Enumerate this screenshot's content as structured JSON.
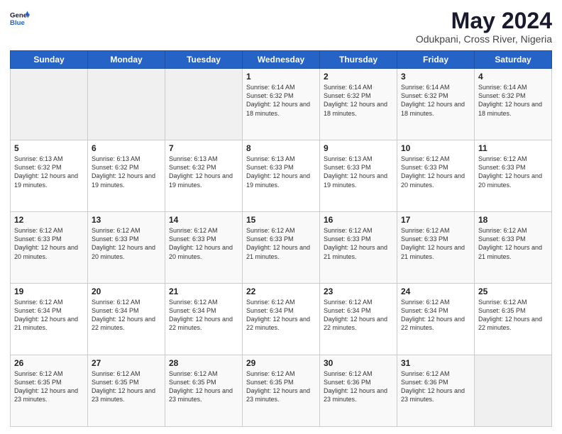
{
  "header": {
    "logo_general": "General",
    "logo_blue": "Blue",
    "month_title": "May 2024",
    "location": "Odukpani, Cross River, Nigeria"
  },
  "calendar": {
    "days_of_week": [
      "Sunday",
      "Monday",
      "Tuesday",
      "Wednesday",
      "Thursday",
      "Friday",
      "Saturday"
    ],
    "rows": [
      [
        {
          "day": "",
          "info": ""
        },
        {
          "day": "",
          "info": ""
        },
        {
          "day": "",
          "info": ""
        },
        {
          "day": "1",
          "info": "Sunrise: 6:14 AM\nSunset: 6:32 PM\nDaylight: 12 hours and 18 minutes."
        },
        {
          "day": "2",
          "info": "Sunrise: 6:14 AM\nSunset: 6:32 PM\nDaylight: 12 hours and 18 minutes."
        },
        {
          "day": "3",
          "info": "Sunrise: 6:14 AM\nSunset: 6:32 PM\nDaylight: 12 hours and 18 minutes."
        },
        {
          "day": "4",
          "info": "Sunrise: 6:14 AM\nSunset: 6:32 PM\nDaylight: 12 hours and 18 minutes."
        }
      ],
      [
        {
          "day": "5",
          "info": "Sunrise: 6:13 AM\nSunset: 6:32 PM\nDaylight: 12 hours and 19 minutes."
        },
        {
          "day": "6",
          "info": "Sunrise: 6:13 AM\nSunset: 6:32 PM\nDaylight: 12 hours and 19 minutes."
        },
        {
          "day": "7",
          "info": "Sunrise: 6:13 AM\nSunset: 6:32 PM\nDaylight: 12 hours and 19 minutes."
        },
        {
          "day": "8",
          "info": "Sunrise: 6:13 AM\nSunset: 6:33 PM\nDaylight: 12 hours and 19 minutes."
        },
        {
          "day": "9",
          "info": "Sunrise: 6:13 AM\nSunset: 6:33 PM\nDaylight: 12 hours and 19 minutes."
        },
        {
          "day": "10",
          "info": "Sunrise: 6:12 AM\nSunset: 6:33 PM\nDaylight: 12 hours and 20 minutes."
        },
        {
          "day": "11",
          "info": "Sunrise: 6:12 AM\nSunset: 6:33 PM\nDaylight: 12 hours and 20 minutes."
        }
      ],
      [
        {
          "day": "12",
          "info": "Sunrise: 6:12 AM\nSunset: 6:33 PM\nDaylight: 12 hours and 20 minutes."
        },
        {
          "day": "13",
          "info": "Sunrise: 6:12 AM\nSunset: 6:33 PM\nDaylight: 12 hours and 20 minutes."
        },
        {
          "day": "14",
          "info": "Sunrise: 6:12 AM\nSunset: 6:33 PM\nDaylight: 12 hours and 20 minutes."
        },
        {
          "day": "15",
          "info": "Sunrise: 6:12 AM\nSunset: 6:33 PM\nDaylight: 12 hours and 21 minutes."
        },
        {
          "day": "16",
          "info": "Sunrise: 6:12 AM\nSunset: 6:33 PM\nDaylight: 12 hours and 21 minutes."
        },
        {
          "day": "17",
          "info": "Sunrise: 6:12 AM\nSunset: 6:33 PM\nDaylight: 12 hours and 21 minutes."
        },
        {
          "day": "18",
          "info": "Sunrise: 6:12 AM\nSunset: 6:33 PM\nDaylight: 12 hours and 21 minutes."
        }
      ],
      [
        {
          "day": "19",
          "info": "Sunrise: 6:12 AM\nSunset: 6:34 PM\nDaylight: 12 hours and 21 minutes."
        },
        {
          "day": "20",
          "info": "Sunrise: 6:12 AM\nSunset: 6:34 PM\nDaylight: 12 hours and 22 minutes."
        },
        {
          "day": "21",
          "info": "Sunrise: 6:12 AM\nSunset: 6:34 PM\nDaylight: 12 hours and 22 minutes."
        },
        {
          "day": "22",
          "info": "Sunrise: 6:12 AM\nSunset: 6:34 PM\nDaylight: 12 hours and 22 minutes."
        },
        {
          "day": "23",
          "info": "Sunrise: 6:12 AM\nSunset: 6:34 PM\nDaylight: 12 hours and 22 minutes."
        },
        {
          "day": "24",
          "info": "Sunrise: 6:12 AM\nSunset: 6:34 PM\nDaylight: 12 hours and 22 minutes."
        },
        {
          "day": "25",
          "info": "Sunrise: 6:12 AM\nSunset: 6:35 PM\nDaylight: 12 hours and 22 minutes."
        }
      ],
      [
        {
          "day": "26",
          "info": "Sunrise: 6:12 AM\nSunset: 6:35 PM\nDaylight: 12 hours and 23 minutes."
        },
        {
          "day": "27",
          "info": "Sunrise: 6:12 AM\nSunset: 6:35 PM\nDaylight: 12 hours and 23 minutes."
        },
        {
          "day": "28",
          "info": "Sunrise: 6:12 AM\nSunset: 6:35 PM\nDaylight: 12 hours and 23 minutes."
        },
        {
          "day": "29",
          "info": "Sunrise: 6:12 AM\nSunset: 6:35 PM\nDaylight: 12 hours and 23 minutes."
        },
        {
          "day": "30",
          "info": "Sunrise: 6:12 AM\nSunset: 6:36 PM\nDaylight: 12 hours and 23 minutes."
        },
        {
          "day": "31",
          "info": "Sunrise: 6:12 AM\nSunset: 6:36 PM\nDaylight: 12 hours and 23 minutes."
        },
        {
          "day": "",
          "info": ""
        }
      ]
    ]
  }
}
